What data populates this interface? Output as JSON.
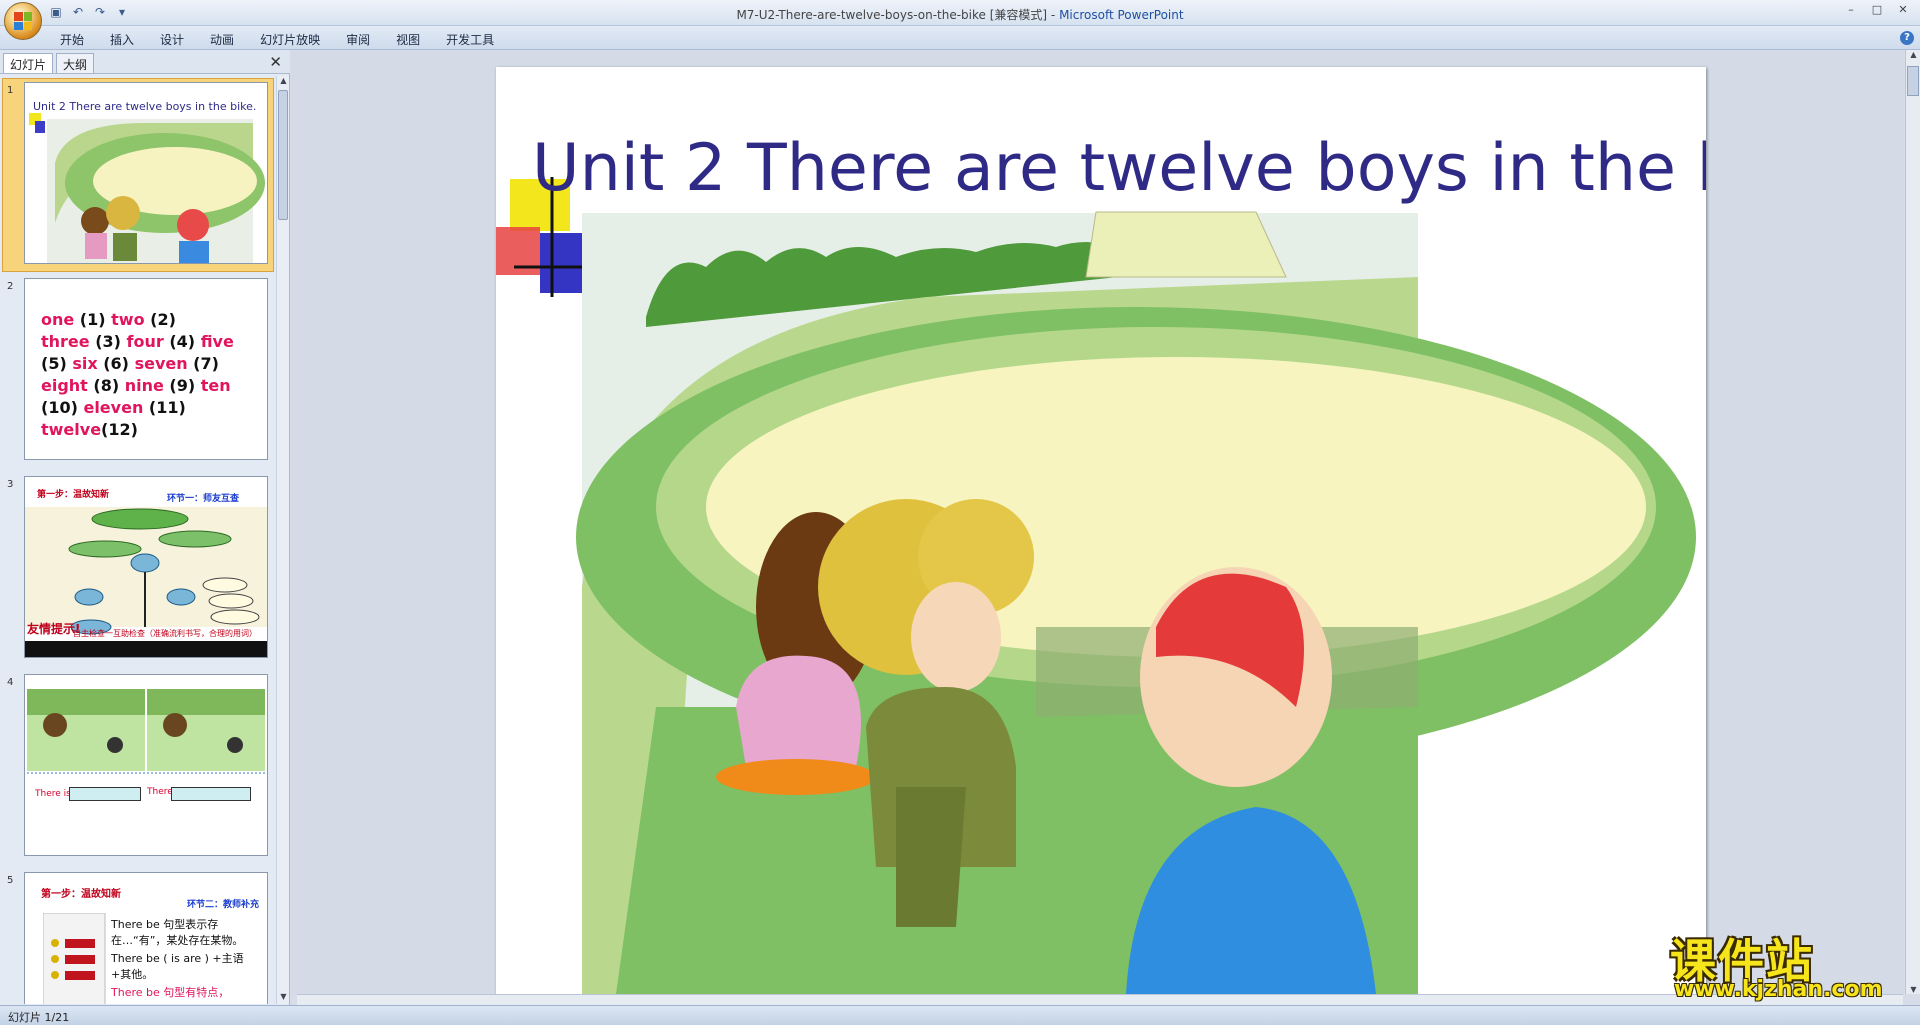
{
  "window": {
    "title_prefix": "M7-U2-There-are-twelve-boys-on-the-bike [兼容模式] - ",
    "app_name": "Microsoft PowerPoint"
  },
  "ribbon": {
    "tabs": [
      "开始",
      "插入",
      "设计",
      "动画",
      "幻灯片放映",
      "审阅",
      "视图",
      "开发工具"
    ]
  },
  "left_pane": {
    "tab_slides": "幻灯片",
    "tab_outline": "大纲"
  },
  "thumbnails": {
    "t1": {
      "num": "1",
      "title": "Unit 2 There are twelve boys in the bike."
    },
    "t2": {
      "num": "2",
      "lines": [
        [
          "one",
          " (1) ",
          "two",
          " (2)"
        ],
        [
          "three",
          " (3) ",
          "four",
          " (4) ",
          "five"
        ],
        [
          "",
          "(5) ",
          "six",
          " (6) ",
          "seven",
          " (7)"
        ],
        [
          "eight",
          " (8) ",
          "nine",
          " (9) ",
          "ten"
        ],
        [
          "",
          "(10) ",
          "eleven",
          " (11)"
        ],
        [
          "twelve",
          "(12)"
        ]
      ]
    },
    "t3": {
      "num": "3",
      "head": "第一步：温故知新",
      "sub": "环节一：师友互查",
      "tip": "友情提示!",
      "tip2": "自主检查一互助检查（准确流利书写，合理的用词）"
    },
    "t4": {
      "num": "4",
      "label_a": "There is",
      "label_b": "There"
    },
    "t5": {
      "num": "5",
      "head": "第一步：温故知新",
      "sub": "环节二：教师补充",
      "line1": "There be 句型表示存在…“有”，某处存在某物。",
      "line2": "There be ( is are ) +主语 +其他。",
      "line3": "There be 句型有特点，"
    }
  },
  "slide": {
    "title": "Unit 2 There are twelve boys in the bike."
  },
  "statusbar": {
    "slide_info": "幻灯片 1/21"
  },
  "watermark": {
    "main": "课件站",
    "sub": "www.kjzhan.com"
  },
  "colors": {
    "title_blue": "#2f2a85",
    "pink": "#e0155e",
    "selection": "#f7d37b"
  }
}
